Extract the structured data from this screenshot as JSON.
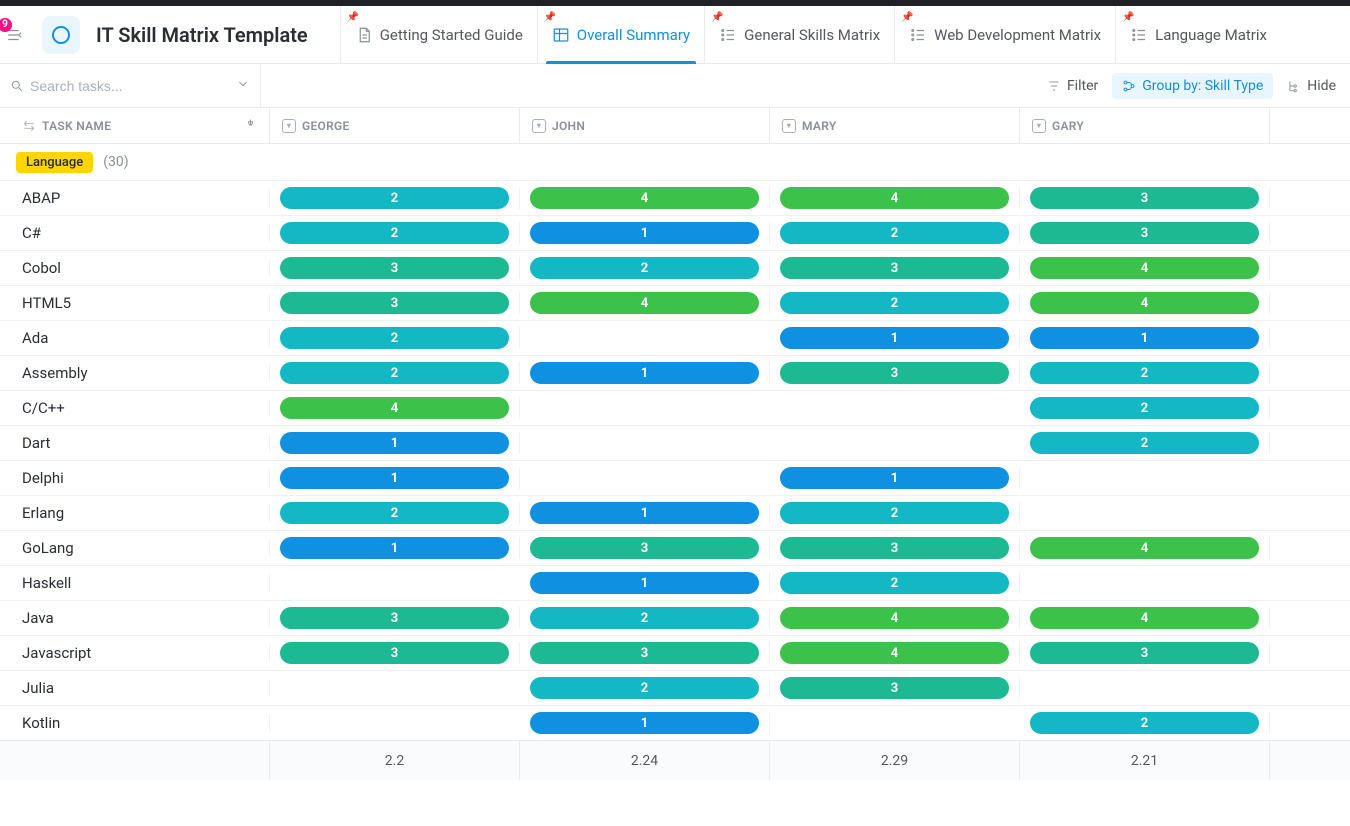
{
  "badge_count": "9",
  "title": "IT Skill Matrix Template",
  "tabs": [
    {
      "label": "Getting Started Guide"
    },
    {
      "label": "Overall Summary"
    },
    {
      "label": "General Skills Matrix"
    },
    {
      "label": "Web Development Matrix"
    },
    {
      "label": "Language Matrix"
    }
  ],
  "search_placeholder": "Search tasks...",
  "toolbar": {
    "filter": "Filter",
    "groupby": "Group by: Skill Type",
    "hide": "Hide"
  },
  "columns": {
    "task": "TASK NAME",
    "people": [
      "GEORGE",
      "JOHN",
      "MARY",
      "GARY"
    ]
  },
  "group": {
    "label": "Language",
    "count": "(30)"
  },
  "rows": [
    {
      "task": "ABAP",
      "vals": [
        2,
        4,
        4,
        3
      ]
    },
    {
      "task": "C#",
      "vals": [
        2,
        1,
        2,
        3
      ]
    },
    {
      "task": "Cobol",
      "vals": [
        3,
        2,
        3,
        4
      ]
    },
    {
      "task": "HTML5",
      "vals": [
        3,
        4,
        2,
        4
      ]
    },
    {
      "task": "Ada",
      "vals": [
        2,
        null,
        1,
        1
      ]
    },
    {
      "task": "Assembly",
      "vals": [
        2,
        1,
        3,
        2
      ]
    },
    {
      "task": "C/C++",
      "vals": [
        4,
        null,
        null,
        2
      ]
    },
    {
      "task": "Dart",
      "vals": [
        1,
        null,
        null,
        2
      ]
    },
    {
      "task": "Delphi",
      "vals": [
        1,
        null,
        1,
        null
      ]
    },
    {
      "task": "Erlang",
      "vals": [
        2,
        1,
        2,
        null
      ]
    },
    {
      "task": "GoLang",
      "vals": [
        1,
        3,
        3,
        4
      ]
    },
    {
      "task": "Haskell",
      "vals": [
        null,
        1,
        2,
        null
      ]
    },
    {
      "task": "Java",
      "vals": [
        3,
        2,
        4,
        4
      ]
    },
    {
      "task": "Javascript",
      "vals": [
        3,
        3,
        4,
        3
      ]
    },
    {
      "task": "Julia",
      "vals": [
        null,
        2,
        3,
        null
      ]
    },
    {
      "task": "Kotlin",
      "vals": [
        null,
        1,
        null,
        2
      ]
    }
  ],
  "footer": [
    "2.2",
    "2.24",
    "2.29",
    "2.21"
  ]
}
